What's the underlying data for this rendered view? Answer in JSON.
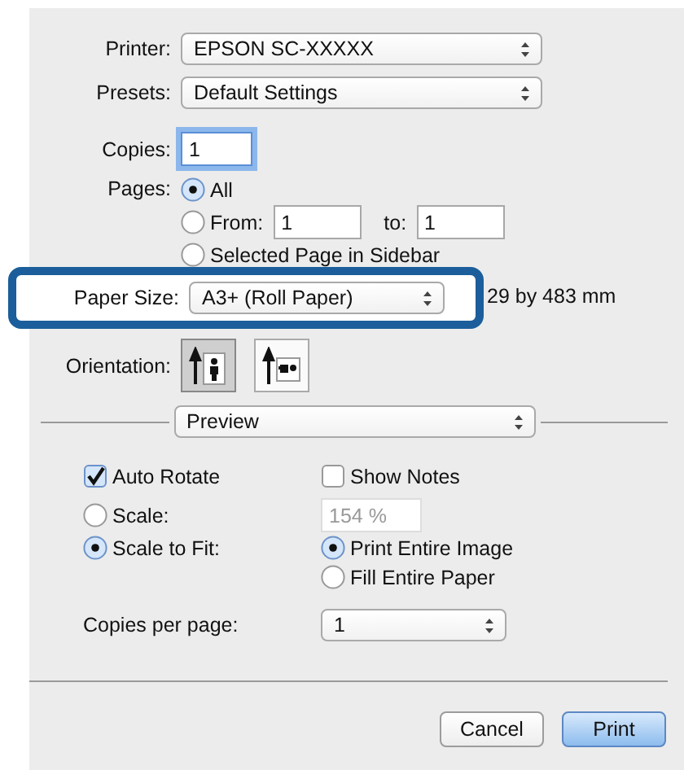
{
  "printer": {
    "label": "Printer:",
    "value": "EPSON SC-XXXXX"
  },
  "presets": {
    "label": "Presets:",
    "value": "Default Settings"
  },
  "copies": {
    "label": "Copies:",
    "value": "1"
  },
  "pages": {
    "label": "Pages:",
    "options": [
      {
        "kind": "plain",
        "label": "All",
        "selected": true
      },
      {
        "kind": "range",
        "label": "From:",
        "from": "1",
        "to_label": "to:",
        "to": "1",
        "selected": false
      },
      {
        "kind": "plain",
        "label": "Selected Page in Sidebar",
        "selected": false
      }
    ]
  },
  "paper_size": {
    "label": "Paper Size:",
    "value": "A3+ (Roll Paper)",
    "dimensions": "29 by 483 mm",
    "highlighted": true
  },
  "orientation": {
    "label": "Orientation:",
    "options": [
      {
        "kind": "portrait",
        "selected": true
      },
      {
        "kind": "landscape",
        "selected": false
      }
    ]
  },
  "section": {
    "value": "Preview"
  },
  "auto_rotate": {
    "label": "Auto Rotate",
    "checked": true
  },
  "show_notes": {
    "label": "Show Notes",
    "checked": false
  },
  "scale": {
    "label": "Scale:",
    "selected": false,
    "value": "154 %",
    "disabled": true
  },
  "scale_to_fit": {
    "label": "Scale to Fit:",
    "selected": true,
    "options": [
      {
        "label": "Print Entire Image",
        "selected": true
      },
      {
        "label": "Fill Entire Paper",
        "selected": false
      }
    ]
  },
  "copies_per_page": {
    "label": "Copies per page:",
    "value": "1"
  },
  "buttons": [
    {
      "label": "Cancel",
      "default": false
    },
    {
      "label": "Print",
      "default": true
    }
  ]
}
